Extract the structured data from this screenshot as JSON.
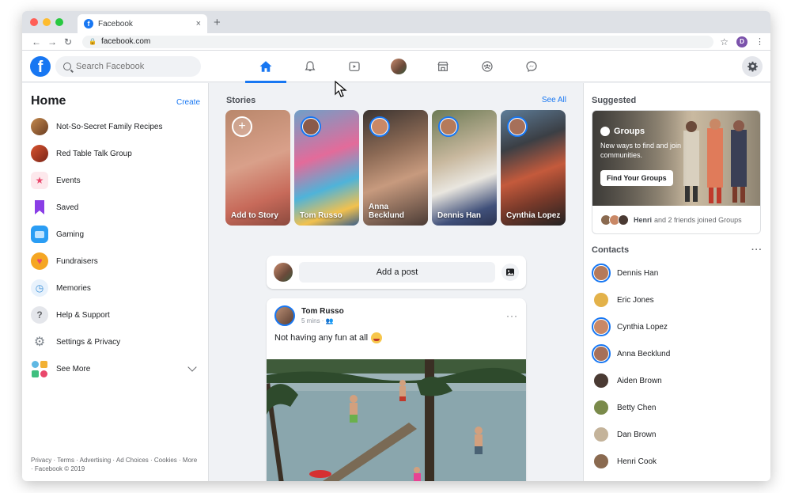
{
  "browser": {
    "tab_title": "Facebook",
    "tab_close": "×",
    "new_tab": "+",
    "url": "facebook.com",
    "profile_initial": "D"
  },
  "fb": {
    "logo_letter": "f",
    "search_placeholder": "Search Facebook",
    "nav": [
      "home-icon",
      "bell-icon",
      "video-icon",
      "profile-avatar",
      "marketplace-icon",
      "groups-icon",
      "messenger-icon"
    ],
    "accent": "#1877f2"
  },
  "left": {
    "title": "Home",
    "create": "Create",
    "items": [
      {
        "label": "Not-So-Secret Family Recipes",
        "icon": "group-thumb",
        "color": "#8a5a3c"
      },
      {
        "label": "Red Table Talk Group",
        "icon": "group-thumb",
        "color": "#b5452e"
      },
      {
        "label": "Events",
        "icon": "calendar-star-icon",
        "color": "#e9476b"
      },
      {
        "label": "Saved",
        "icon": "bookmark-icon",
        "color": "#8a3ee6"
      },
      {
        "label": "Gaming",
        "icon": "gaming-icon",
        "color": "#2a9df4"
      },
      {
        "label": "Fundraisers",
        "icon": "heart-icon",
        "color": "#f5a623"
      },
      {
        "label": "Memories",
        "icon": "clock-icon",
        "color": "#3a8fd8"
      },
      {
        "label": "Help & Support",
        "icon": "question-icon",
        "color": "#bcc0c4"
      },
      {
        "label": "Settings & Privacy",
        "icon": "gear-icon",
        "color": "#9aa0a6"
      },
      {
        "label": "See More",
        "icon": "apps-icon",
        "color": "#5fb8e3"
      }
    ],
    "footer": "Privacy · Terms · Advertising · Ad Choices · Cookies · More · Facebook © 2019"
  },
  "stories": {
    "title": "Stories",
    "see_all": "See All",
    "items": [
      {
        "name": "Add to Story",
        "bg": "linear-gradient(160deg,#b9876b,#d9a08a 45%,#c76a5a 75%,#8c4a3e)"
      },
      {
        "name": "Tom Russo",
        "bg": "linear-gradient(160deg,#6fa0c8,#e36b9a 40%,#4fb3d9 65%,#f2c14e 85%,#3a5f8a)"
      },
      {
        "name": "Anna Becklund",
        "bg": "linear-gradient(160deg,#3a3330,#8c6a55 35%,#c79a7e 60%,#4a3b35)"
      },
      {
        "name": "Dennis Han",
        "bg": "linear-gradient(160deg,#6c7a55,#c8b89e 40%,#e9e6df 62%,#40507a 85%,#2b3350)"
      },
      {
        "name": "Cynthia Lopez",
        "bg": "linear-gradient(160deg,#5e7d99,#3b3f45 30%,#c45a3c 55%,#7a3a2a 75%,#222)"
      }
    ]
  },
  "composer": {
    "placeholder": "Add a post"
  },
  "post": {
    "author": "Tom Russo",
    "time": "5 mins",
    "text": "Not having any fun at all",
    "more": "···"
  },
  "right": {
    "suggested": "Suggested",
    "groups_title": "Groups",
    "groups_desc": "New ways to find and join communities.",
    "groups_button": "Find Your Groups",
    "groups_footer_name": "Henri",
    "groups_footer_text": "and 2 friends joined Groups",
    "contacts_title": "Contacts",
    "contacts_more": "···",
    "contacts": [
      {
        "name": "Dennis Han",
        "ring": true,
        "color": "#b57a5a"
      },
      {
        "name": "Eric Jones",
        "ring": false,
        "color": "#e3b24a"
      },
      {
        "name": "Cynthia Lopez",
        "ring": true,
        "color": "#c98866"
      },
      {
        "name": "Anna Becklund",
        "ring": true,
        "color": "#a6705a"
      },
      {
        "name": "Aiden Brown",
        "ring": false,
        "color": "#4a3a33"
      },
      {
        "name": "Betty Chen",
        "ring": false,
        "color": "#7a8a4a"
      },
      {
        "name": "Dan Brown",
        "ring": false,
        "color": "#c4b39a"
      },
      {
        "name": "Henri Cook",
        "ring": false,
        "color": "#8a6a50"
      }
    ]
  }
}
